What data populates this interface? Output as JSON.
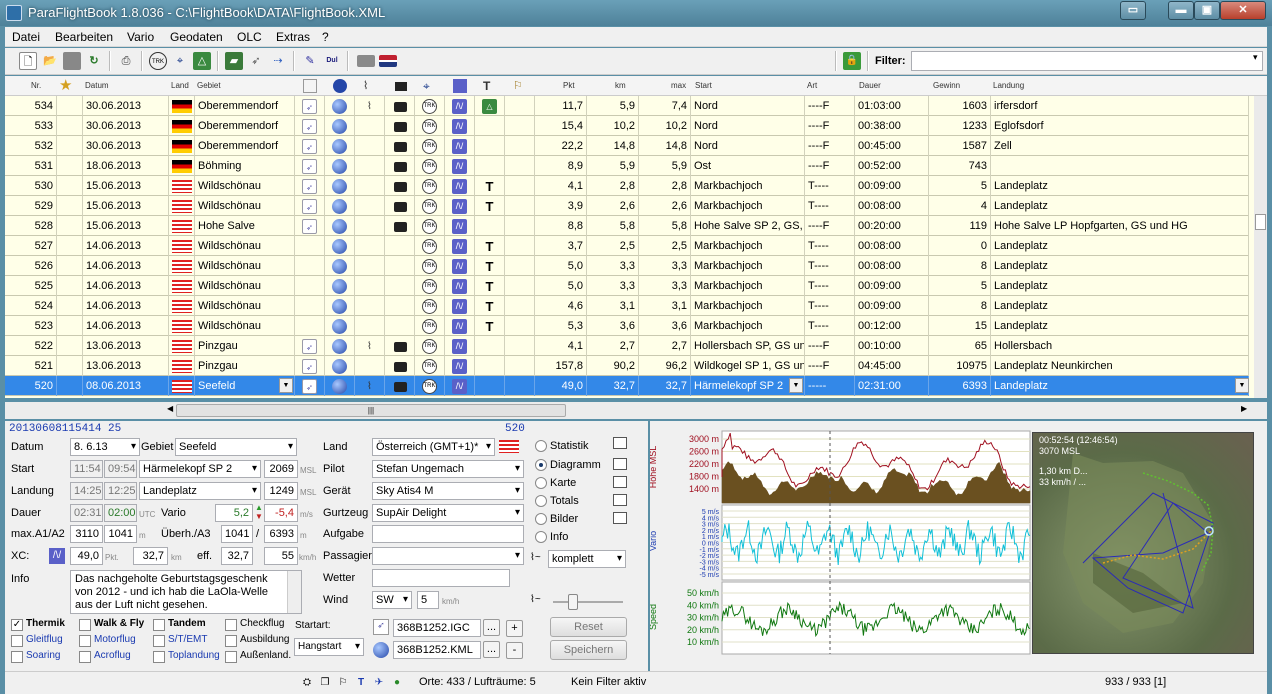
{
  "window": {
    "title": "ParaFlightBook 1.8.036 - C:\\FlightBook\\DATA\\FlightBook.XML",
    "buttons": [
      "▭",
      "▬",
      "▣",
      "✕"
    ]
  },
  "menu": [
    "Datei",
    "Bearbeiten",
    "Vario",
    "Geodaten",
    "OLC",
    "Extras",
    "?"
  ],
  "toolbar": {
    "icons": [
      "new-file-icon",
      "open-folder-icon",
      "save-icon",
      "refresh-icon",
      "print-icon",
      "trk-icon",
      "gps-icon",
      "mountain-icon",
      "book-icon",
      "route-icon",
      "export-icon",
      "pen-icon",
      "olc-icon",
      "gray-flag-icon",
      "uk-flag-icon",
      "lock-icon"
    ],
    "filter_label": "Filter:",
    "filter_value": ""
  },
  "table": {
    "headers": [
      "Nr.",
      "★",
      "Datum",
      "Land",
      "Gebiet",
      "Pkt",
      "km",
      "max",
      "Start",
      "Art",
      "Dauer",
      "Gewinn",
      "Landung"
    ],
    "rows": [
      {
        "nr": "534",
        "datum": "30.06.2013",
        "land": "de",
        "gebiet": "Oberemmendorf",
        "pkt": "11,7",
        "km": "5,9",
        "max": "7,4",
        "start": "Nord",
        "art": "----F",
        "dauer": "01:03:00",
        "gewinn": "1603",
        "landung": "irfersdorf",
        "icons": [
          "route",
          "globe",
          "graph",
          "cam",
          "trk",
          "vario",
          "mountain"
        ]
      },
      {
        "nr": "533",
        "datum": "30.06.2013",
        "land": "de",
        "gebiet": "Oberemmendorf",
        "pkt": "15,4",
        "km": "10,2",
        "max": "10,2",
        "start": "Nord",
        "art": "----F",
        "dauer": "00:38:00",
        "gewinn": "1233",
        "landung": "Eglofsdorf",
        "icons": [
          "route",
          "globe",
          "",
          "cam",
          "trk",
          "vario",
          ""
        ]
      },
      {
        "nr": "532",
        "datum": "30.06.2013",
        "land": "de",
        "gebiet": "Oberemmendorf",
        "pkt": "22,2",
        "km": "14,8",
        "max": "14,8",
        "start": "Nord",
        "art": "----F",
        "dauer": "00:45:00",
        "gewinn": "1587",
        "landung": "Zell",
        "icons": [
          "route",
          "globe",
          "",
          "cam",
          "trk",
          "vario",
          ""
        ]
      },
      {
        "nr": "531",
        "datum": "18.06.2013",
        "land": "de",
        "gebiet": "Böhming",
        "pkt": "8,9",
        "km": "5,9",
        "max": "5,9",
        "start": "Ost",
        "art": "----F",
        "dauer": "00:52:00",
        "gewinn": "743",
        "landung": "",
        "icons": [
          "route",
          "globe",
          "",
          "cam",
          "trk",
          "vario",
          ""
        ]
      },
      {
        "nr": "530",
        "datum": "15.06.2013",
        "land": "at",
        "gebiet": "Wildschönau",
        "pkt": "4,1",
        "km": "2,8",
        "max": "2,8",
        "start": "Markbachjoch",
        "art": "T----",
        "dauer": "00:09:00",
        "gewinn": "5",
        "landung": "Landeplatz",
        "icons": [
          "route",
          "globe",
          "",
          "cam",
          "trk",
          "vario",
          "thermal"
        ]
      },
      {
        "nr": "529",
        "datum": "15.06.2013",
        "land": "at",
        "gebiet": "Wildschönau",
        "pkt": "3,9",
        "km": "2,6",
        "max": "2,6",
        "start": "Markbachjoch",
        "art": "T----",
        "dauer": "00:08:00",
        "gewinn": "4",
        "landung": "Landeplatz",
        "icons": [
          "route",
          "globe",
          "",
          "cam",
          "trk",
          "vario",
          "thermal"
        ]
      },
      {
        "nr": "528",
        "datum": "15.06.2013",
        "land": "at",
        "gebiet": "Hohe Salve",
        "pkt": "8,8",
        "km": "5,8",
        "max": "5,8",
        "start": "Hohe Salve SP 2, GS,",
        "art": "----F",
        "dauer": "00:20:00",
        "gewinn": "119",
        "landung": "Hohe Salve LP Hopfgarten, GS und HG",
        "icons": [
          "route",
          "globe",
          "",
          "cam",
          "trk",
          "vario",
          ""
        ]
      },
      {
        "nr": "527",
        "datum": "14.06.2013",
        "land": "at",
        "gebiet": "Wildschönau",
        "pkt": "3,7",
        "km": "2,5",
        "max": "2,5",
        "start": "Markbachjoch",
        "art": "T----",
        "dauer": "00:08:00",
        "gewinn": "0",
        "landung": "Landeplatz",
        "icons": [
          "",
          "globe",
          "",
          "",
          "trk",
          "vario",
          "thermal"
        ]
      },
      {
        "nr": "526",
        "datum": "14.06.2013",
        "land": "at",
        "gebiet": "Wildschönau",
        "pkt": "5,0",
        "km": "3,3",
        "max": "3,3",
        "start": "Markbachjoch",
        "art": "T----",
        "dauer": "00:08:00",
        "gewinn": "8",
        "landung": "Landeplatz",
        "icons": [
          "",
          "globe",
          "",
          "",
          "trk",
          "vario",
          "thermal"
        ]
      },
      {
        "nr": "525",
        "datum": "14.06.2013",
        "land": "at",
        "gebiet": "Wildschönau",
        "pkt": "5,0",
        "km": "3,3",
        "max": "3,3",
        "start": "Markbachjoch",
        "art": "T----",
        "dauer": "00:09:00",
        "gewinn": "5",
        "landung": "Landeplatz",
        "icons": [
          "",
          "globe",
          "",
          "",
          "trk",
          "vario",
          "thermal"
        ]
      },
      {
        "nr": "524",
        "datum": "14.06.2013",
        "land": "at",
        "gebiet": "Wildschönau",
        "pkt": "4,6",
        "km": "3,1",
        "max": "3,1",
        "start": "Markbachjoch",
        "art": "T----",
        "dauer": "00:09:00",
        "gewinn": "8",
        "landung": "Landeplatz",
        "icons": [
          "",
          "globe",
          "",
          "",
          "trk",
          "vario",
          "thermal"
        ]
      },
      {
        "nr": "523",
        "datum": "14.06.2013",
        "land": "at",
        "gebiet": "Wildschönau",
        "pkt": "5,3",
        "km": "3,6",
        "max": "3,6",
        "start": "Markbachjoch",
        "art": "T----",
        "dauer": "00:12:00",
        "gewinn": "15",
        "landung": "Landeplatz",
        "icons": [
          "",
          "globe",
          "",
          "",
          "trk",
          "vario",
          "thermal"
        ]
      },
      {
        "nr": "522",
        "datum": "13.06.2013",
        "land": "at",
        "gebiet": "Pinzgau",
        "pkt": "4,1",
        "km": "2,7",
        "max": "2,7",
        "start": "Hollersbach SP, GS un",
        "art": "----F",
        "dauer": "00:10:00",
        "gewinn": "65",
        "landung": "Hollersbach",
        "icons": [
          "route",
          "globe",
          "graph",
          "cam",
          "trk",
          "vario",
          ""
        ]
      },
      {
        "nr": "521",
        "datum": "13.06.2013",
        "land": "at",
        "gebiet": "Pinzgau",
        "pkt": "157,8",
        "km": "90,2",
        "max": "96,2",
        "start": "Wildkogel SP 1, GS un",
        "art": "----F",
        "dauer": "04:45:00",
        "gewinn": "10975",
        "landung": "Landeplatz Neunkirchen",
        "icons": [
          "route",
          "globe",
          "",
          "cam",
          "trk",
          "vario",
          ""
        ]
      },
      {
        "nr": "520",
        "datum": "08.06.2013",
        "land": "at",
        "gebiet": "Seefeld",
        "pkt": "49,0",
        "km": "32,7",
        "max": "32,7",
        "start": "Härmelekopf SP 2",
        "art": "-----",
        "dauer": "02:31:00",
        "gewinn": "6393",
        "landung": "Landeplatz",
        "icons": [
          "route",
          "globe",
          "graph",
          "cam",
          "trk",
          "vario",
          ""
        ],
        "selected": true
      }
    ]
  },
  "detail": {
    "flight_id": "20130608115414 25",
    "flight_nr": "520",
    "datum_label": "Datum",
    "datum": "8. 6.13",
    "gebiet_label": "Gebiet",
    "gebiet": "Seefeld",
    "start_label": "Start",
    "start_time": "11:54",
    "start_utc": "09:54",
    "start_place": "Härmelekopf SP 2",
    "start_alt": "2069",
    "msl": "MSL",
    "landung_label": "Landung",
    "land_time": "14:25",
    "land_utc": "12:25",
    "land_place": "Landeplatz",
    "land_alt": "1249",
    "dauer_label": "Dauer",
    "dauer": "02:31",
    "dauer_utc": "02:00",
    "utc": "UTC",
    "vario_label": "Vario",
    "vario_max": "5,2",
    "vario_min": "-5,4",
    "vario_unit": "m/s",
    "maxa_label": "max.A1/A2",
    "maxa1": "3110",
    "maxa2": "1041",
    "m": "m",
    "uberh_label": "Überh./A3",
    "uberh": "1041",
    "slash": "/",
    "a3": "6393",
    "xc_label": "XC:",
    "xc": "49,0",
    "pkt": "Pkt.",
    "km_val": "32,7",
    "km": "km",
    "eff_label": "eff.",
    "eff": "32,7",
    "speed": "55",
    "kmh": "km/h",
    "info_label": "Info",
    "info": "Das nachgeholte Geburtstagsgeschenk von 2012 - und ich hab die LaOla-Welle aus der Luft nicht gesehen.",
    "land_label": "Land",
    "land": "Österreich (GMT+1)*",
    "pilot_label": "Pilot",
    "pilot": "Stefan Ungemach",
    "gerat_label": "Gerät",
    "gerat": "Sky Atis4 M",
    "gurtzeug_label": "Gurtzeug",
    "gurtzeug": "SupAir Delight",
    "aufgabe_label": "Aufgabe",
    "aufgabe": "",
    "passagier_label": "Passagier",
    "passagier": "",
    "wetter_label": "Wetter",
    "wetter": "",
    "wind_label": "Wind",
    "wind_dir": "SW",
    "wind_speed": "5",
    "wind_unit": "km/h",
    "checks": [
      {
        "label": "Thermik",
        "checked": true
      },
      {
        "label": "Walk & Fly",
        "checked": false
      },
      {
        "label": "Tandem",
        "checked": false
      },
      {
        "label": "Checkflug",
        "checked": false
      },
      {
        "label": "Gleitflug",
        "checked": false
      },
      {
        "label": "Motorflug",
        "checked": false
      },
      {
        "label": "S/T/EMT",
        "checked": false
      },
      {
        "label": "Ausbildung",
        "checked": false
      },
      {
        "label": "Soaring",
        "checked": false
      },
      {
        "label": "Acroflug",
        "checked": false
      },
      {
        "label": "Toplandung",
        "checked": false
      },
      {
        "label": "Außenland.",
        "checked": false
      }
    ],
    "startart_label": "Startart:",
    "startart": "Hangstart",
    "igc_file": "368B1252.IGC",
    "kml_file": "368B1252.KML",
    "dots": "...",
    "plus": "+",
    "minus": "-",
    "reset": "Reset",
    "speichern": "Speichern",
    "view_options": [
      {
        "label": "Statistik",
        "selected": false
      },
      {
        "label": "Diagramm",
        "selected": true
      },
      {
        "label": "Karte",
        "selected": false
      },
      {
        "label": "Totals",
        "selected": false
      },
      {
        "label": "Bilder",
        "selected": false
      },
      {
        "label": "Info",
        "selected": false
      }
    ],
    "komplett": "komplett"
  },
  "charts": {
    "alt_axis_title": "Höhe MSL",
    "alt_ticks": [
      "3000 m",
      "2600 m",
      "2200 m",
      "1800 m",
      "1400 m"
    ],
    "vario_axis_title": "Vario",
    "vario_ticks": [
      "5 m/s",
      "4 m/s",
      "3 m/s",
      "2 m/s",
      "1 m/s",
      "0 m/s",
      "-1 m/s",
      "-2 m/s",
      "-3 m/s",
      "-4 m/s",
      "-5 m/s"
    ],
    "speed_axis_title": "Speed",
    "speed_ticks": [
      "50 km/h",
      "40 km/h",
      "30 km/h",
      "20 km/h",
      "10 km/h"
    ]
  },
  "map": {
    "line1": "00:52:54 (12:46:54)",
    "line2": "3070 MSL",
    "line3": "1,30 km D...",
    "line4": "33 km/h / ..."
  },
  "status": {
    "orte": "Orte: 433 / Lufträume: 5",
    "filter": "Kein Filter aktiv",
    "count": "933 / 933 [1]"
  }
}
